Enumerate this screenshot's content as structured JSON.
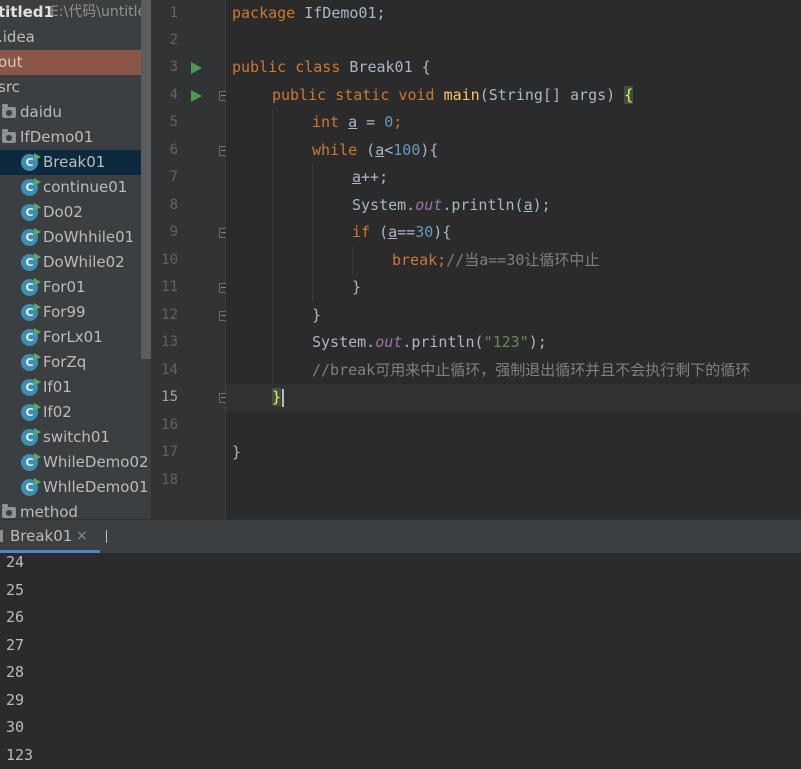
{
  "project": {
    "title": "titled1",
    "path": "E:\\代码\\untitle",
    "items": [
      {
        "label": ".idea"
      },
      {
        "label": "out"
      },
      {
        "label": "src"
      },
      {
        "label": "daidu"
      },
      {
        "label": "IfDemo01"
      },
      {
        "label": "Break01"
      },
      {
        "label": "continue01"
      },
      {
        "label": "Do02"
      },
      {
        "label": "DoWhhile01"
      },
      {
        "label": "DoWhile02"
      },
      {
        "label": "For01"
      },
      {
        "label": "For99"
      },
      {
        "label": "ForLx01"
      },
      {
        "label": "ForZq"
      },
      {
        "label": "If01"
      },
      {
        "label": "If02"
      },
      {
        "label": "switch01"
      },
      {
        "label": "WhileDemo02"
      },
      {
        "label": "WhlleDemo01"
      },
      {
        "label": "method"
      }
    ]
  },
  "editor": {
    "line_numbers": [
      "1",
      "2",
      "3",
      "4",
      "5",
      "6",
      "7",
      "8",
      "9",
      "10",
      "11",
      "12",
      "13",
      "14",
      "15",
      "16",
      "17",
      "18"
    ],
    "current_line": "15",
    "code": {
      "l1": {
        "kw": "package",
        "rest": " IfDemo01;"
      },
      "l3": {
        "kw": "public class",
        "rest": " Break01 {"
      },
      "l4": {
        "kw": "public static void",
        "fn": "main",
        "rest": "(String[] args) ",
        "brace": "{"
      },
      "l5": {
        "kw": "int",
        "var": "a",
        "mid": " = ",
        "num": "0",
        "end": ";"
      },
      "l6": {
        "kw": "while",
        "open": " (",
        "var": "a",
        "op": "<",
        "num": "100",
        "end": "){"
      },
      "l7": {
        "var": "a",
        "end": "++;"
      },
      "l8": {
        "pre": "System.",
        "fld": "out",
        "mid": ".println(",
        "var": "a",
        "end": ");"
      },
      "l9": {
        "kw": "if",
        "open": " (",
        "var": "a",
        "op": "==",
        "num": "30",
        "end": "){"
      },
      "l10": {
        "kw": "break;",
        "cm": "//当a==30让循环中止"
      },
      "l11": {
        "text": "}"
      },
      "l12": {
        "text": "}"
      },
      "l13": {
        "pre": "System.",
        "fld": "out",
        "mid": ".println(",
        "str": "\"123\"",
        "end": ");"
      },
      "l14": {
        "cm": "//break可用来中止循环，强制退出循环并且不会执行剩下的循环"
      },
      "l15": {
        "brace": "}"
      },
      "l17": {
        "text": "}"
      }
    }
  },
  "run": {
    "tab_label": "Break01",
    "close_glyph": "×",
    "output": [
      "24",
      "25",
      "26",
      "27",
      "28",
      "29",
      "30",
      "123"
    ]
  },
  "colors": {
    "keyword": "#cc7832",
    "function": "#ffc66d",
    "number": "#6897bb",
    "string": "#6a8759",
    "comment": "#808080",
    "field": "#9876aa",
    "run_icon": "#499c54",
    "selected_folder": "#8b5548",
    "selected_class": "#0d293e"
  }
}
